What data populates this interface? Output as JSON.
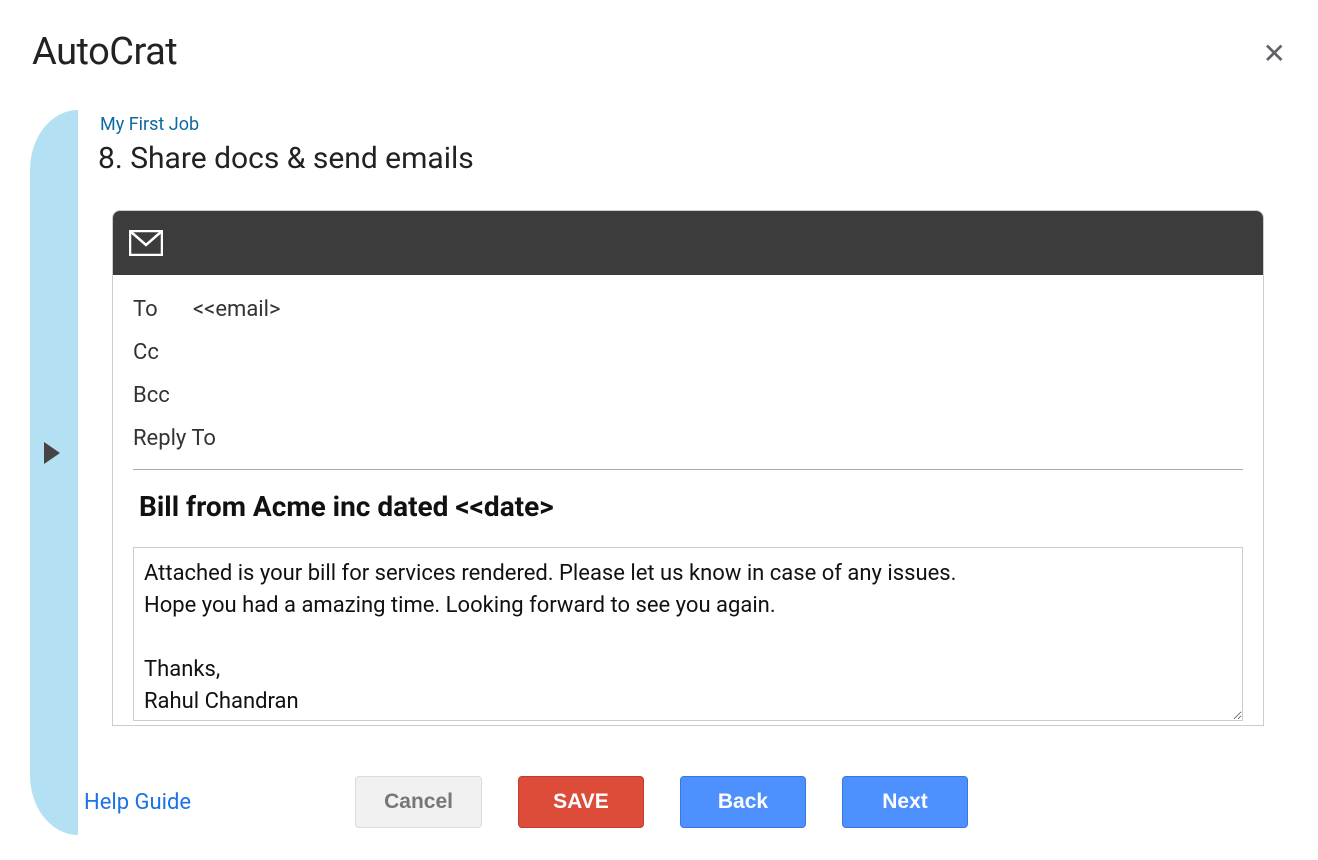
{
  "app": {
    "title": "AutoCrat"
  },
  "job": {
    "name": "My First Job",
    "step_heading": "8. Share docs & send emails"
  },
  "email": {
    "to_label": "To",
    "to_value": "<<email>",
    "cc_label": "Cc",
    "cc_value": "",
    "bcc_label": "Bcc",
    "bcc_value": "",
    "reply_to_label": "Reply To",
    "reply_to_value": "",
    "subject": "Bill from Acme inc dated <<date>",
    "body": "Attached is your bill for services rendered. Please let us know in case of any issues.\nHope you had a amazing time. Looking forward to see you again.\n\nThanks,\nRahul Chandran"
  },
  "footer": {
    "help_label": "Help Guide",
    "cancel_label": "Cancel",
    "save_label": "SAVE",
    "back_label": "Back",
    "next_label": "Next"
  }
}
